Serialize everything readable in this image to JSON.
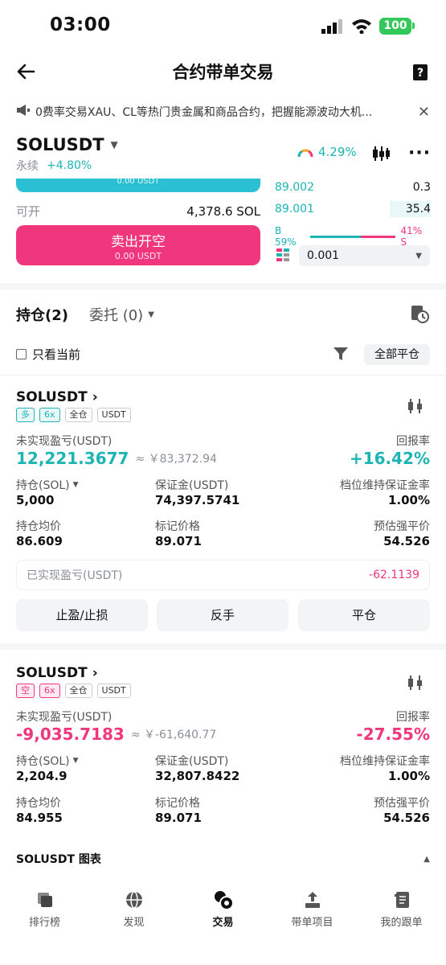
{
  "status_bar": {
    "time": "03:00",
    "battery": "100"
  },
  "header": {
    "title": "合约带单交易"
  },
  "notice": {
    "text": "0费率交易XAU、CL等热门贵金属和商品合约，把握能源波动大机..."
  },
  "instrument": {
    "symbol": "SOLUSDT",
    "type": "永续",
    "change": "+4.80%",
    "indicator_pct": "4.29%"
  },
  "trade_panel": {
    "buy_sub": "0.00 USDT",
    "available_label": "可开",
    "available_value": "4,378.6 SOL",
    "sell_label": "卖出开空",
    "sell_sub": "0.00 USDT"
  },
  "orderbook": {
    "rows": [
      {
        "price": "89.002",
        "qty": "0.3"
      },
      {
        "price": "89.001",
        "qty": "35.4"
      }
    ],
    "buy_ratio": "B 59%",
    "sell_ratio": "41% S",
    "precision": "0.001"
  },
  "tabs": {
    "positions": "持仓(2)",
    "orders": "委托 (0)"
  },
  "filter": {
    "only_current": "只看当前",
    "close_all": "全部平仓"
  },
  "positions": [
    {
      "symbol": "SOLUSDT",
      "side": "多",
      "leverage": "6x",
      "margin_mode": "全仓",
      "currency": "USDT",
      "pnl_label": "未实现盈亏(USDT)",
      "pnl_value": "12,221.3677",
      "pnl_cny": "≈ ￥83,372.94",
      "roi_label": "回报率",
      "roi_value": "+16.42%",
      "size_label": "持仓(SOL)",
      "size_value": "5,000",
      "margin_label": "保证金(USDT)",
      "margin_value": "74,397.5741",
      "mmr_label": "档位维持保证金率",
      "mmr_value": "1.00%",
      "entry_label": "持仓均价",
      "entry_value": "86.609",
      "mark_label": "标记价格",
      "mark_value": "89.071",
      "liq_label": "预估强平价",
      "liq_value": "54.526",
      "realized_label": "已实现盈亏(USDT)",
      "realized_value": "-62.1139",
      "btn_tpsl": "止盈/止损",
      "btn_reverse": "反手",
      "btn_close": "平仓"
    },
    {
      "symbol": "SOLUSDT",
      "side": "空",
      "leverage": "6x",
      "margin_mode": "全仓",
      "currency": "USDT",
      "pnl_label": "未实现盈亏(USDT)",
      "pnl_value": "-9,035.7183",
      "pnl_cny": "≈ ￥-61,640.77",
      "roi_label": "回报率",
      "roi_value": "-27.55%",
      "size_label": "持仓(SOL)",
      "size_value": "2,204.9",
      "margin_label": "保证金(USDT)",
      "margin_value": "32,807.8422",
      "mmr_label": "档位维持保证金率",
      "mmr_value": "1.00%",
      "entry_label": "持仓均价",
      "entry_value": "84.955",
      "mark_label": "标记价格",
      "mark_value": "89.071",
      "liq_label": "预估强平价",
      "liq_value": "54.526"
    }
  ],
  "chart_section": {
    "label": "SOLUSDT 图表"
  },
  "bottom_nav": [
    {
      "label": "排行榜"
    },
    {
      "label": "发现"
    },
    {
      "label": "交易"
    },
    {
      "label": "带单项目"
    },
    {
      "label": "我的跟单"
    }
  ]
}
